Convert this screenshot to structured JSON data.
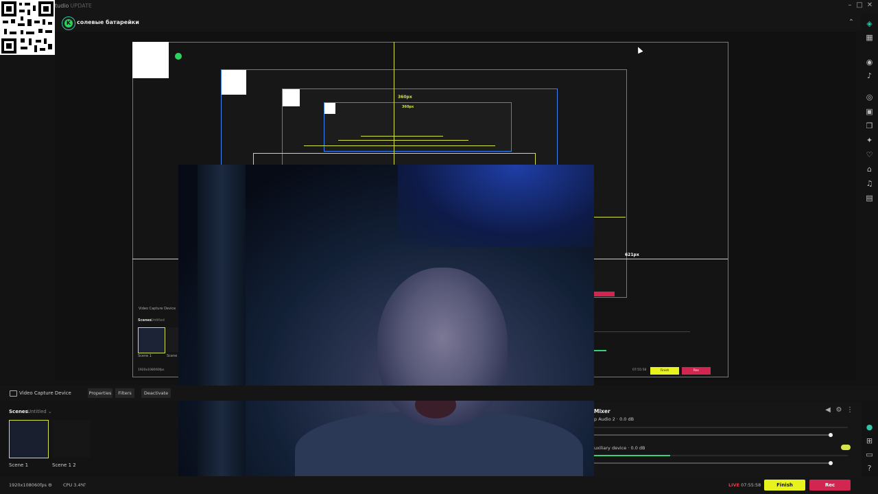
{
  "app": {
    "title": "tudio",
    "update": "UPDATE",
    "channel": "солевые батарейки",
    "logo_letter": "K"
  },
  "window_controls": {
    "minimize": "–",
    "maximize": "□",
    "close": "✕",
    "collapse": "⌃"
  },
  "preview": {
    "dim_vertical": "360px",
    "dim_vertical_inner": "360px",
    "dim_horizontal": "621px"
  },
  "nested_scene": {
    "source": "Video Capture Device",
    "scenes_title": "Scenes",
    "collection": "Untitled",
    "scene1": "Scene 1",
    "scene2": "Scene 1",
    "resolution": "1920x1080",
    "fps": "60fps",
    "time": "07:55:58",
    "finish": "Finish",
    "rec": "Rec"
  },
  "source_bar": {
    "source_name": "Video Capture Device",
    "properties": "Properties",
    "filters": "Filters",
    "deactivate": "Deactivate"
  },
  "scenes": {
    "title": "Scenes",
    "collection": "Untitled",
    "items": [
      {
        "label": "Scene 1"
      },
      {
        "label": "Scene 1 2"
      }
    ]
  },
  "mixer": {
    "title": "Mixer",
    "rows": [
      {
        "label": "p Audio 2 · 0.0 dB",
        "level": 0.0
      },
      {
        "label": "uxiliary device · 0.0 dB",
        "level": 0.3
      }
    ]
  },
  "footer": {
    "resolution": "1920x1080",
    "fps": "60fps",
    "cpu": "CPU 3.4%",
    "live": "LIVE",
    "time": "07:55:58",
    "finish": "Finish",
    "rec": "Rec"
  },
  "colors": {
    "accent": "#d6e44a",
    "live": "#e23b4a",
    "finish": "#e8f21c",
    "rec": "#d0264f",
    "selection": "#3b82f6",
    "logo": "#2fd15e"
  },
  "icons": [
    "studio-mode-icon",
    "layout-icon",
    "dashboard-icon",
    "chat-icon",
    "notifications-icon",
    "camera-icon",
    "video-icon",
    "layers-icon",
    "sparkles-icon",
    "heart-icon",
    "tag-icon",
    "music-icon",
    "clipboard-icon",
    "prime-icon",
    "apps-icon",
    "help-icon",
    "settings-icon"
  ]
}
